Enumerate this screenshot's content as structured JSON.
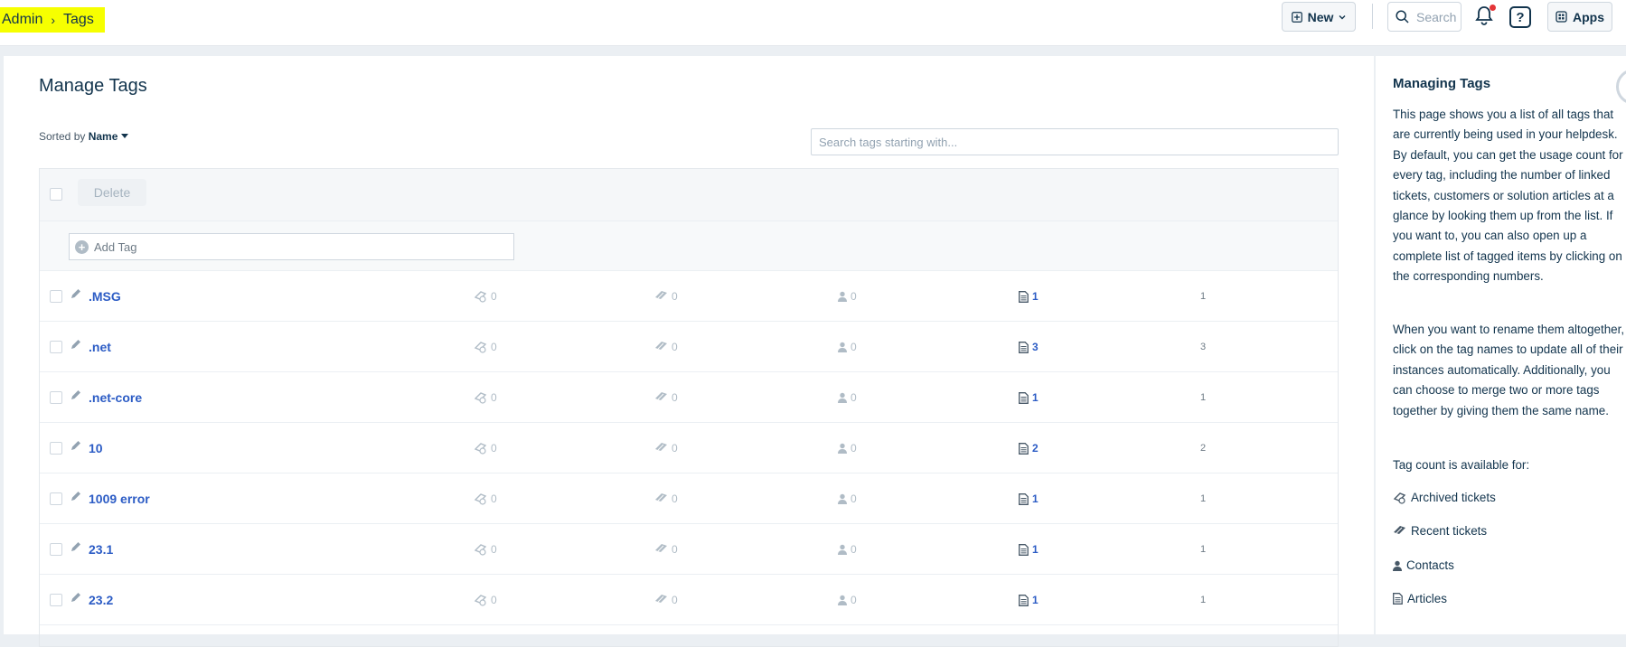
{
  "breadcrumb": {
    "parent": "Admin",
    "separator": "›",
    "current": "Tags"
  },
  "header": {
    "new_label": "New",
    "search_placeholder": "Search",
    "help_label": "?",
    "apps_label": "Apps"
  },
  "main": {
    "title": "Manage Tags",
    "sorted_prefix": "Sorted by",
    "sorted_value": "Name",
    "search_placeholder": "Search tags starting with...",
    "delete_label": "Delete",
    "add_tag_placeholder": "Add Tag"
  },
  "rows": [
    {
      "name": ".MSG",
      "archived": "0",
      "recent": "0",
      "contacts": "0",
      "articles": "1",
      "total": "1"
    },
    {
      "name": ".net",
      "archived": "0",
      "recent": "0",
      "contacts": "0",
      "articles": "3",
      "total": "3"
    },
    {
      "name": ".net-core",
      "archived": "0",
      "recent": "0",
      "contacts": "0",
      "articles": "1",
      "total": "1"
    },
    {
      "name": "10",
      "archived": "0",
      "recent": "0",
      "contacts": "0",
      "articles": "2",
      "total": "2"
    },
    {
      "name": "1009 error",
      "archived": "0",
      "recent": "0",
      "contacts": "0",
      "articles": "1",
      "total": "1"
    },
    {
      "name": "23.1",
      "archived": "0",
      "recent": "0",
      "contacts": "0",
      "articles": "1",
      "total": "1"
    },
    {
      "name": "23.2",
      "archived": "0",
      "recent": "0",
      "contacts": "0",
      "articles": "1",
      "total": "1"
    }
  ],
  "sidebar": {
    "title": "Managing Tags",
    "para1": "This page shows you a list of all tags that are currently being used in your helpdesk. By default, you can get the usage count for every tag, including the number of linked tickets, customers or solution articles at a glance by looking them up from the list. If you want to, you can also open up a complete list of tagged items by clicking on the corresponding numbers.",
    "para2": "When you want to rename them altogether, click on the tag names to update all of their instances automatically. Additionally, you can choose to merge two or more tags together by giving them the same name.",
    "para3": "Tag count is available for:",
    "legend": {
      "archived": "Archived tickets",
      "recent": "Recent tickets",
      "contacts": "Contacts",
      "articles": "Articles"
    }
  },
  "colors": {
    "highlight": "#f6ff00",
    "link": "#2c5cc5",
    "text": "#12344d",
    "muted": "#b0bcc6",
    "notification": "#e43538"
  }
}
